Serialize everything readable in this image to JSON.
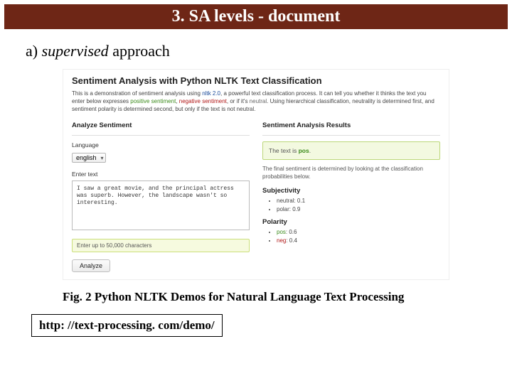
{
  "slide": {
    "title": "3. SA levels - document",
    "subhead_prefix": "a) ",
    "subhead_italic": "supervised",
    "subhead_rest": " approach",
    "caption": "Fig. 2 Python NLTK Demos for Natural Language Text Processing",
    "url": "http: //text-processing. com/demo/"
  },
  "demo": {
    "heading": "Sentiment Analysis with Python NLTK Text Classification",
    "blurb_1a": "This is a demonstration of sentiment analysis using ",
    "blurb_nltk": "nltk 2.0",
    "blurb_1b": ", a powerful text classification process. It can tell you whether it thinks the text you enter below expresses ",
    "blurb_pos": "positive sentiment",
    "blurb_mid": ", ",
    "blurb_neg": "negative sentiment",
    "blurb_or": ", or if it's ",
    "blurb_neu": "neutral",
    "blurb_2": ". Using hierarchical classification, neutrality is determined first, and sentiment polarity is determined second, but only if the text is not neutral.",
    "left_heading": "Analyze Sentiment",
    "lang_label": "Language",
    "lang_value": "english",
    "text_label": "Enter text",
    "text_value": "I saw a great movie, and the principal actress was superb. However, the landscape wasn't so interesting.",
    "counter": "Enter up to 50,000 characters",
    "analyze_btn": "Analyze",
    "right_heading": "Sentiment Analysis Results",
    "result_prefix": "The text is ",
    "result_label": "pos",
    "result_suffix": ".",
    "explain": "The final sentiment is determined by looking at the classification probabilities below.",
    "subj_heading": "Subjectivity",
    "subj_neutral": "neutral: 0.1",
    "subj_polar": "polar: 0.9",
    "pol_heading": "Polarity",
    "pol_pos_label": "pos",
    "pol_pos_val": ": 0.6",
    "pol_neg_label": "neg",
    "pol_neg_val": ": 0.4"
  }
}
